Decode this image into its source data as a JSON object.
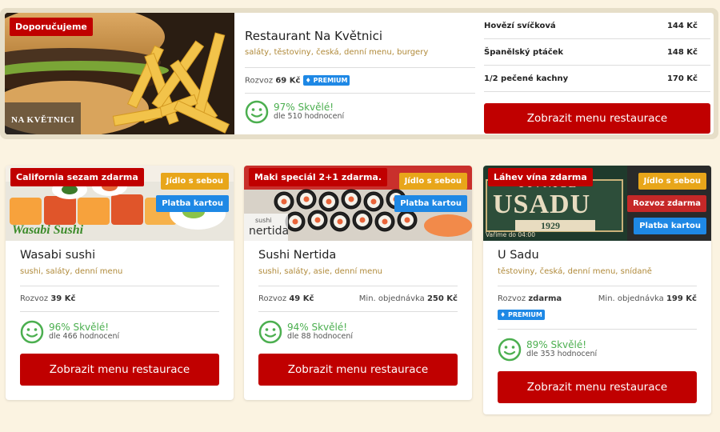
{
  "featured": {
    "badge": "Doporučujeme",
    "logo_text": "NA KVĚTNICI",
    "name": "Restaurant Na Květnici",
    "tags": "saláty, těstoviny, česká, denní menu, burgery",
    "delivery_label": "Rozvoz",
    "delivery_value": "69 Kč",
    "premium": "PREMIUM",
    "score": "97% Skvělé!",
    "reviews": "dle 510 hodnocení",
    "menu": [
      {
        "item": "Hovězí svíčková",
        "price": "144 Kč"
      },
      {
        "item": "Španělský ptáček",
        "price": "148 Kč"
      },
      {
        "item": "1/2 pečené kachny",
        "price": "170 Kč"
      }
    ],
    "button": "Zobrazit menu restaurace"
  },
  "cards": [
    {
      "badge": "California sezam zdarma",
      "pills": [
        "Jídlo s sebou",
        "Platba kartou"
      ],
      "logo_text": "Wasabi Sushi",
      "name": "Wasabi sushi",
      "tags": "sushi, saláty, denní menu",
      "delivery_label": "Rozvoz",
      "delivery_value": "39 Kč",
      "score": "96% Skvělé!",
      "reviews": "dle 466 hodnocení",
      "button": "Zobrazit menu restaurace"
    },
    {
      "badge": "Maki speciál 2+1 zdarma.",
      "pills": [
        "Jídlo s sebou",
        "Platba kartou"
      ],
      "logo_text": "nertida",
      "logo_sub": "sushi",
      "name": "Sushi Nertida",
      "tags": "sushi, saláty, asie, denní menu",
      "delivery_label": "Rozvoz",
      "delivery_value": "49 Kč",
      "min_label": "Min. objednávka",
      "min_value": "250 Kč",
      "score": "94% Skvělé!",
      "reviews": "dle 88 hodnocení",
      "button": "Zobrazit menu restaurace"
    },
    {
      "badge": "Láhev vína zdarma",
      "pills": [
        "Jídlo s sebou",
        "Rozvoz zdarma",
        "Platba kartou"
      ],
      "sign_top": "PIVNICE",
      "sign_main": "USADU",
      "sign_year": "1929",
      "sign_note": "Vaříme do 04:00",
      "name": "U Sadu",
      "tags": "těstoviny, česká, denní menu, snídaně",
      "delivery_label": "Rozvoz",
      "delivery_value": "zdarma",
      "min_label": "Min. objednávka",
      "min_value": "199 Kč",
      "premium": "PREMIUM",
      "score": "89% Skvělé!",
      "reviews": "dle 353 hodnocení",
      "button": "Zobrazit menu restaurace"
    }
  ],
  "colors": {
    "accent_red": "#c00000",
    "rating_green": "#4caf50",
    "tag_gold": "#b08a3a",
    "pill_yellow": "#e8a61a",
    "pill_blue": "#1e88e5"
  }
}
